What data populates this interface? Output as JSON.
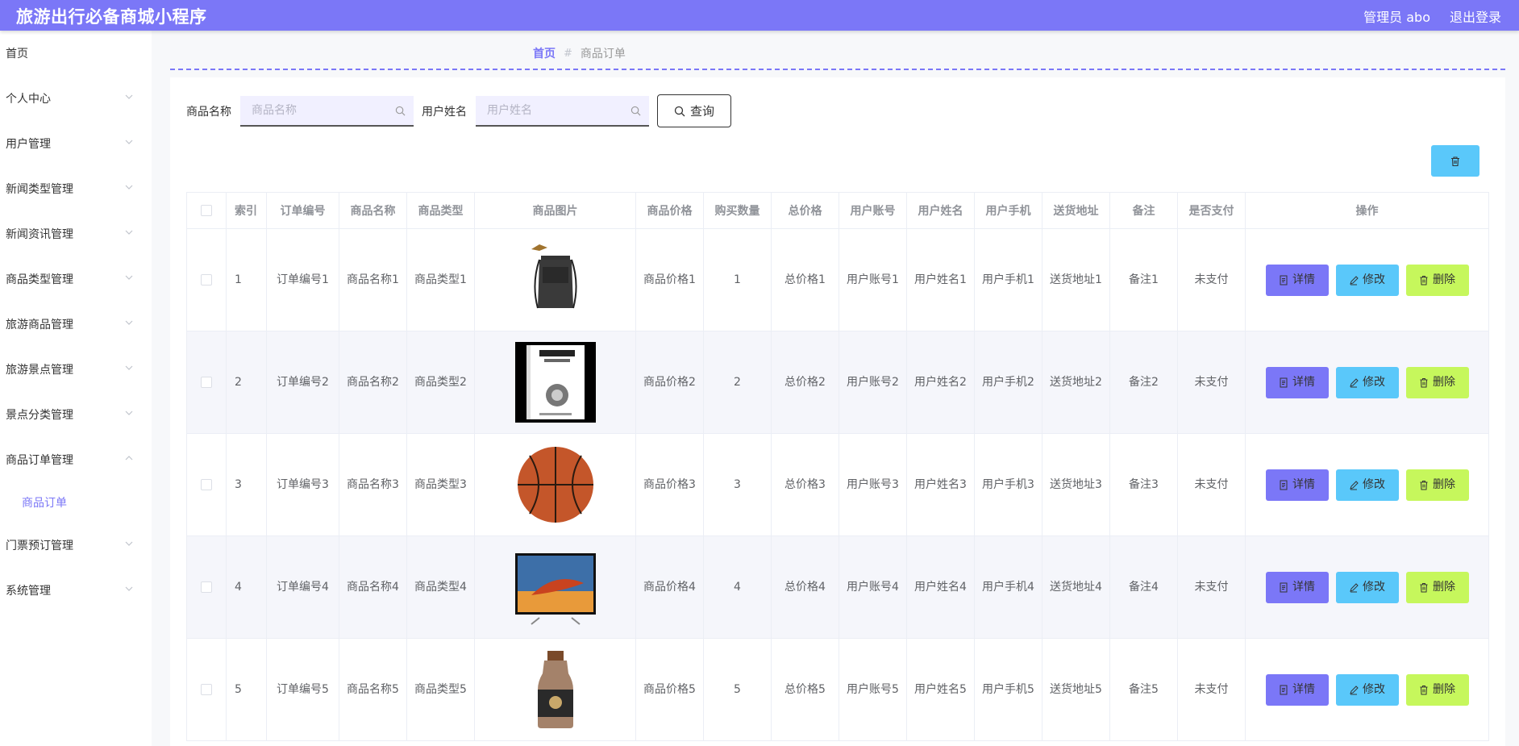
{
  "app": {
    "title": "旅游出行必备商城小程序",
    "admin_label": "管理员 abo",
    "logout_label": "退出登录"
  },
  "sidebar": {
    "items": [
      {
        "label": "首页"
      },
      {
        "label": "个人中心"
      },
      {
        "label": "用户管理"
      },
      {
        "label": "新闻类型管理"
      },
      {
        "label": "新闻资讯管理"
      },
      {
        "label": "商品类型管理"
      },
      {
        "label": "旅游商品管理"
      },
      {
        "label": "旅游景点管理"
      },
      {
        "label": "景点分类管理"
      },
      {
        "label": "商品订单管理"
      },
      {
        "label": "门票预订管理"
      },
      {
        "label": "系统管理"
      }
    ],
    "submenu": {
      "label": "商品订单"
    }
  },
  "breadcrumb": {
    "home": "首页",
    "separator": "#",
    "current": "商品订单"
  },
  "search": {
    "field1_label": "商品名称",
    "field1_placeholder": "商品名称",
    "field2_label": "用户姓名",
    "field2_placeholder": "用户姓名",
    "query_label": "查询"
  },
  "table": {
    "headers": [
      "索引",
      "订单编号",
      "商品名称",
      "商品类型",
      "商品图片",
      "商品价格",
      "购买数量",
      "总价格",
      "用户账号",
      "用户姓名",
      "用户手机",
      "送货地址",
      "备注",
      "是否支付",
      "操作"
    ],
    "rows": [
      {
        "index": "1",
        "order_no": "订单编号1",
        "name": "商品名称1",
        "type": "商品类型1",
        "price": "商品价格1",
        "qty": "1",
        "total": "总价格1",
        "account": "用户账号1",
        "uname": "用户姓名1",
        "phone": "用户手机1",
        "address": "送货地址1",
        "remark": "备注1",
        "paid": "未支付",
        "image": "shoulder-bag"
      },
      {
        "index": "2",
        "order_no": "订单编号2",
        "name": "商品名称2",
        "type": "商品类型2",
        "price": "商品价格2",
        "qty": "2",
        "total": "总价格2",
        "account": "用户账号2",
        "uname": "用户姓名2",
        "phone": "用户手机2",
        "address": "送货地址2",
        "remark": "备注2",
        "paid": "未支付",
        "image": "book"
      },
      {
        "index": "3",
        "order_no": "订单编号3",
        "name": "商品名称3",
        "type": "商品类型3",
        "price": "商品价格3",
        "qty": "3",
        "total": "总价格3",
        "account": "用户账号3",
        "uname": "用户姓名3",
        "phone": "用户手机3",
        "address": "送货地址3",
        "remark": "备注3",
        "paid": "未支付",
        "image": "basketball"
      },
      {
        "index": "4",
        "order_no": "订单编号4",
        "name": "商品名称4",
        "type": "商品类型4",
        "price": "商品价格4",
        "qty": "4",
        "total": "总价格4",
        "account": "用户账号4",
        "uname": "用户姓名4",
        "phone": "用户手机4",
        "address": "送货地址4",
        "remark": "备注4",
        "paid": "未支付",
        "image": "tv"
      },
      {
        "index": "5",
        "order_no": "订单编号5",
        "name": "商品名称5",
        "type": "商品类型5",
        "price": "商品价格5",
        "qty": "5",
        "total": "总价格5",
        "account": "用户账号5",
        "uname": "用户姓名5",
        "phone": "用户手机5",
        "address": "送货地址5",
        "remark": "备注5",
        "paid": "未支付",
        "image": "milk-tea-bottle"
      }
    ],
    "actions": {
      "detail": "详情",
      "edit": "修改",
      "delete": "删除"
    }
  },
  "colors": {
    "accent": "#7b77f7",
    "edit": "#5ac8fa",
    "delete": "#c6f75c"
  }
}
